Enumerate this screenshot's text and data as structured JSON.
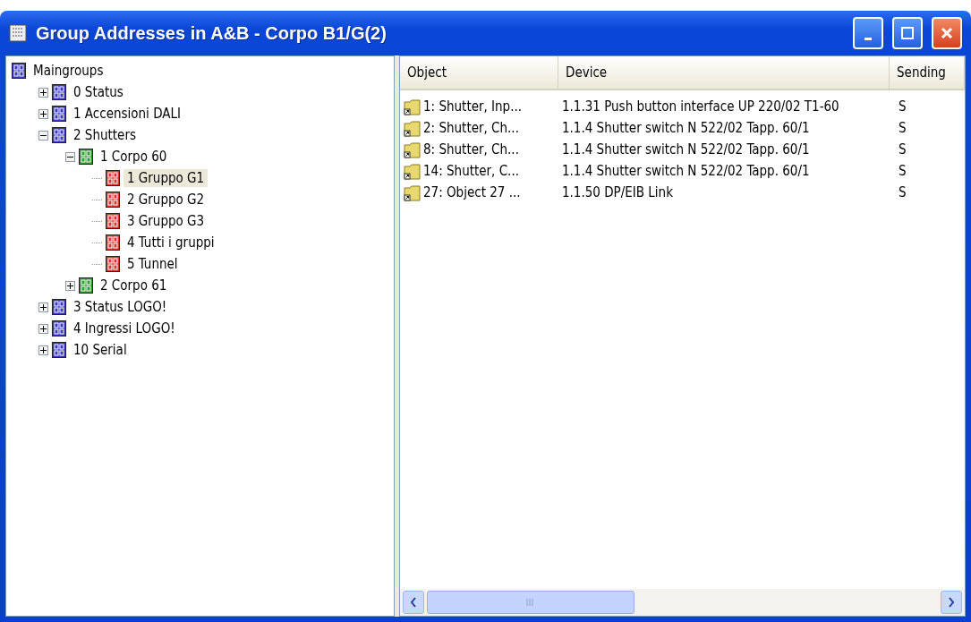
{
  "window": {
    "title": "Group Addresses in A&B - Corpo B1/G(2)"
  },
  "tree": {
    "label": "Maingroups",
    "color": "#3a3ab8",
    "children": [
      {
        "label": "0 Status",
        "color": "#3a3ab8",
        "expanded": false,
        "selected": false
      },
      {
        "label": "1 Accensioni DALI",
        "color": "#3a3ab8",
        "expanded": false,
        "selected": false
      },
      {
        "label": "2 Shutters",
        "color": "#3a3ab8",
        "expanded": true,
        "selected": false,
        "children": [
          {
            "label": "1 Corpo 60",
            "color": "#2f9a2f",
            "expanded": true,
            "selected": false,
            "children": [
              {
                "label": "1 Gruppo G1",
                "color": "#d23a3a",
                "selected": true
              },
              {
                "label": "2 Gruppo G2",
                "color": "#d23a3a",
                "selected": false
              },
              {
                "label": "3 Gruppo G3",
                "color": "#d23a3a",
                "selected": false
              },
              {
                "label": "4 Tutti i gruppi",
                "color": "#d23a3a",
                "selected": false
              },
              {
                "label": "5 Tunnel",
                "color": "#d23a3a",
                "selected": false
              }
            ]
          },
          {
            "label": "2 Corpo 61",
            "color": "#2f9a2f",
            "expanded": false,
            "selected": false
          }
        ]
      },
      {
        "label": "3 Status LOGO!",
        "color": "#3a3ab8",
        "expanded": false,
        "selected": false
      },
      {
        "label": "4 Ingressi LOGO!",
        "color": "#3a3ab8",
        "expanded": false,
        "selected": false
      },
      {
        "label": "10 Serial",
        "color": "#3a3ab8",
        "expanded": false,
        "selected": false
      }
    ]
  },
  "table": {
    "columns": [
      "Object",
      "Device",
      "Sending"
    ],
    "rows": [
      [
        "1: Shutter, Inp...",
        "1.1.31 Push button interface UP 220/02 T1-60",
        "S"
      ],
      [
        "2: Shutter, Ch...",
        "1.1.4 Shutter switch N 522/02 Tapp. 60/1",
        "S"
      ],
      [
        "8: Shutter, Ch...",
        "1.1.4 Shutter switch N 522/02 Tapp. 60/1",
        "S"
      ],
      [
        "14: Shutter, C...",
        "1.1.4 Shutter switch N 522/02 Tapp. 60/1",
        "S"
      ],
      [
        "27: Object 27 ...",
        "1.1.50 DP/EIB Link",
        "S"
      ]
    ]
  }
}
